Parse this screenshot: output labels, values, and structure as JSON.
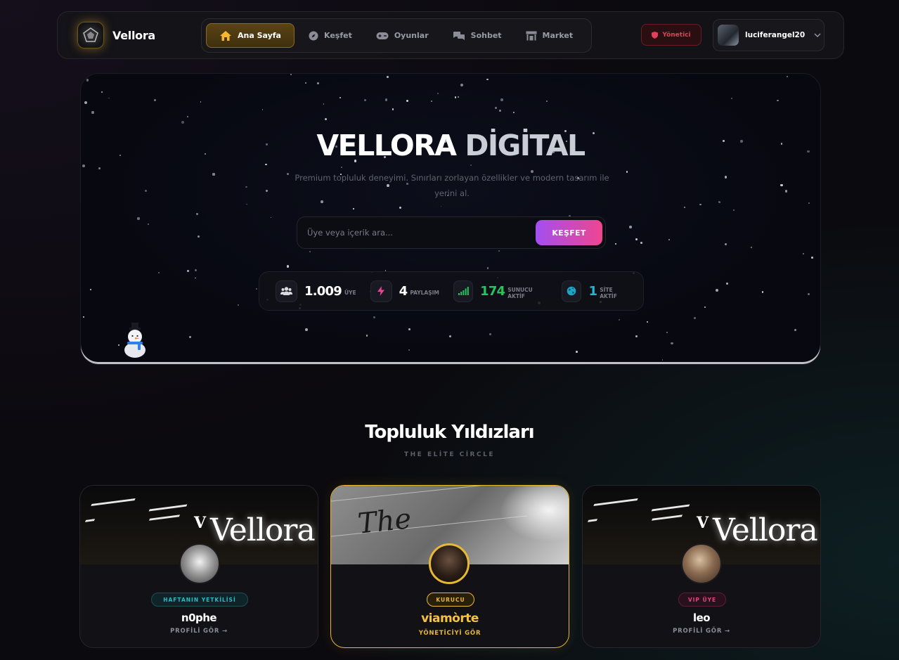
{
  "nav": {
    "brand": "Vellora",
    "items": [
      {
        "label": "Ana Sayfa",
        "icon": "home-icon",
        "active": true
      },
      {
        "label": "Keşfet",
        "icon": "compass-icon",
        "active": false
      },
      {
        "label": "Oyunlar",
        "icon": "gamepad-icon",
        "active": false
      },
      {
        "label": "Sohbet",
        "icon": "chat-icon",
        "active": false
      },
      {
        "label": "Market",
        "icon": "store-icon",
        "active": false
      }
    ],
    "admin_label": "Yönetici",
    "username": "luciferangel20"
  },
  "hero": {
    "title_part1": "VELLORA",
    "title_part2": "DİGİTAL",
    "subtitle": "Premium topluluk deneyimi. Sınırları zorlayan özellikler ve modern tasarım ile yerini al.",
    "search_placeholder": "Üye veya içerik ara...",
    "search_button": "KEŞFET",
    "stats": [
      {
        "value": "1.009",
        "label": "ÜYE",
        "icon": "users-icon",
        "color": "#ffffff"
      },
      {
        "value": "4",
        "label": "PAYLAŞIM",
        "icon": "bolt-icon",
        "color": "#ffffff"
      },
      {
        "value": "174",
        "label": "SUNUCU AKTİF",
        "icon": "signal-icon",
        "color": "#22c55e"
      },
      {
        "value": "1",
        "label": "SİTE AKTİF",
        "icon": "globe-icon",
        "color": "#22b8cf"
      }
    ]
  },
  "section": {
    "title": "Topluluk Yıldızları",
    "subtitle": "THE ELİTE CİRCLE"
  },
  "cards": [
    {
      "badge": "HAFTANIN YETKİLİSİ",
      "name": "n0phe",
      "link": "PROFİLİ GÖR →",
      "badge_color": "#2bb8c8",
      "banner_text": "Vellora"
    },
    {
      "badge": "KURUCU",
      "name": "viamòrte",
      "link": "YÖNETİCİYİ GÖR",
      "badge_color": "#e8b832",
      "banner_text": "The"
    },
    {
      "badge": "VIP ÜYE",
      "name": "leo",
      "link": "PROFİLİ GÖR →",
      "badge_color": "#e0457e",
      "banner_text": "Vellora"
    }
  ],
  "colors": {
    "accent_gold": "#e8b832",
    "accent_pink": "#f0458f",
    "accent_purple": "#a34ff0"
  }
}
